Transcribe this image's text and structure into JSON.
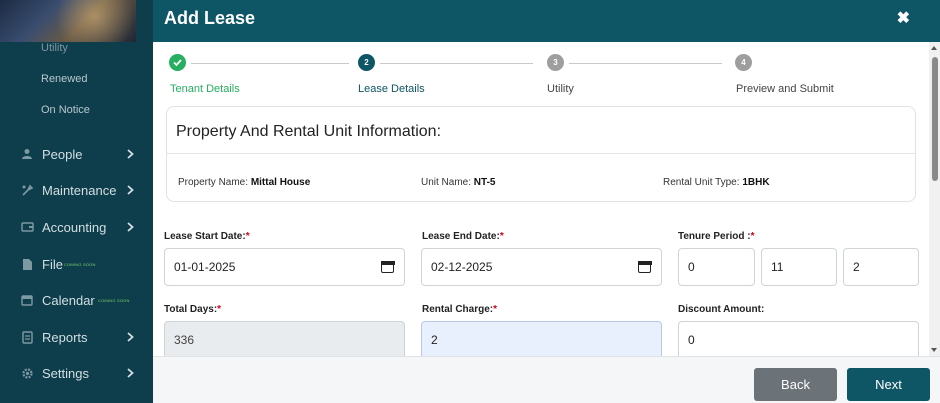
{
  "sidebar": {
    "sub_items": [
      "Utility",
      "Renewed",
      "On Notice"
    ],
    "items": [
      {
        "label": "People",
        "icon": "people-icon",
        "chevron": true
      },
      {
        "label": "Maintenance",
        "icon": "maintenance-icon",
        "chevron": true
      },
      {
        "label": "Accounting",
        "icon": "accounting-icon",
        "chevron": true
      },
      {
        "label": "File",
        "icon": "file-icon",
        "chevron": false,
        "badge": "COMING SOON"
      },
      {
        "label": "Calendar",
        "icon": "calendar-icon",
        "chevron": false,
        "badge": "COMING SOON"
      },
      {
        "label": "Reports",
        "icon": "reports-icon",
        "chevron": true
      },
      {
        "label": "Settings",
        "icon": "settings-icon",
        "chevron": true
      }
    ]
  },
  "modal": {
    "title": "Add Lease",
    "close_icon": "close-icon"
  },
  "stepper": {
    "steps": [
      {
        "number": "✓",
        "label": "Tenant Details",
        "state": "completed"
      },
      {
        "number": "2",
        "label": "Lease Details",
        "state": "active"
      },
      {
        "number": "3",
        "label": "Utility",
        "state": "pending"
      },
      {
        "number": "4",
        "label": "Preview and Submit",
        "state": "pending"
      }
    ]
  },
  "property_card": {
    "title": "Property And Rental Unit Information:",
    "property_name_label": "Property Name:",
    "property_name": "Mittal House",
    "unit_name_label": "Unit Name:",
    "unit_name": "NT-5",
    "unit_type_label": "Rental Unit Type:",
    "unit_type": "1BHK"
  },
  "form": {
    "lease_start_label": "Lease Start Date:",
    "lease_start_value": "01-01-2025",
    "lease_end_label": "Lease End Date:",
    "lease_end_value": "02-12-2025",
    "tenure_label": "Tenure Period :",
    "tenure_years": "0",
    "tenure_months": "11",
    "tenure_days": "2",
    "total_days_label": "Total Days:",
    "total_days_value": "336",
    "rental_charge_label": "Rental Charge:",
    "rental_charge_value": "2",
    "discount_label": "Discount Amount:",
    "discount_value": "0",
    "required_mark": "*"
  },
  "footer": {
    "back_label": "Back",
    "next_label": "Next"
  },
  "colors": {
    "sidebar_bg": "#0e3d4b",
    "header_bg": "#0e5566",
    "completed": "#27ae60",
    "active": "#0e5566",
    "pending": "#9e9e9e",
    "next_button": "#0e5566",
    "back_button": "#6b7378"
  }
}
